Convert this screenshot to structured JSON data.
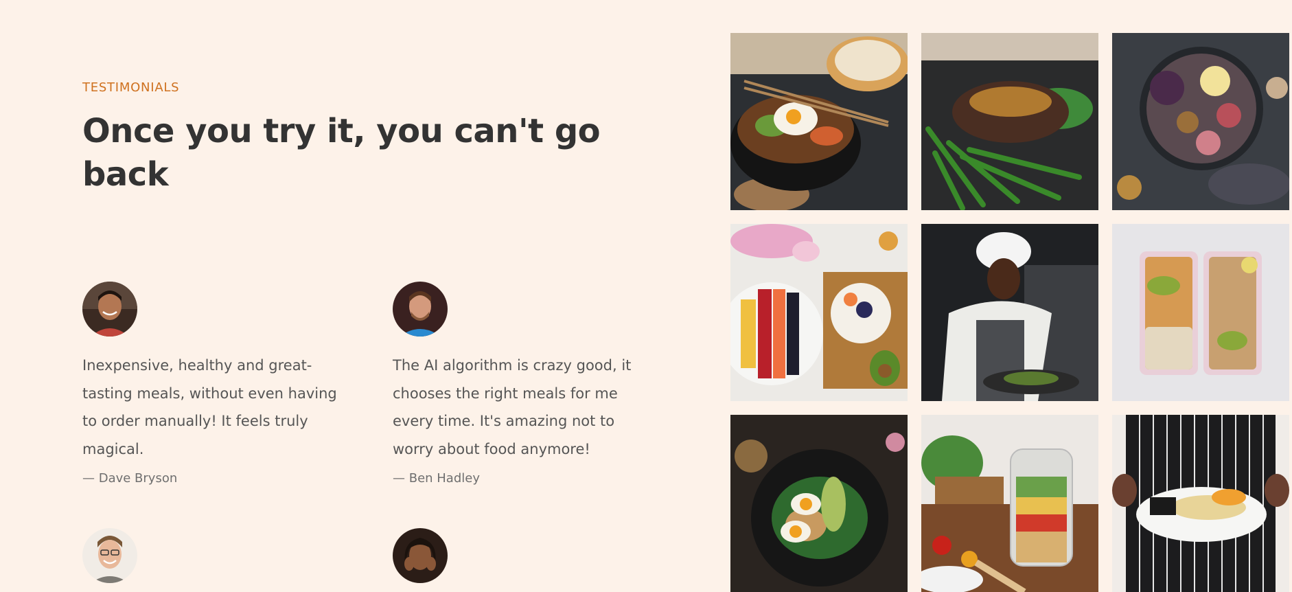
{
  "section": {
    "eyebrow": "Testimonials",
    "heading": "Once you try it, you can't go back"
  },
  "testimonials": [
    {
      "quote": "Inexpensive, healthy and great-tasting meals, without even having to order manually! It feels truly magical.",
      "author": "— Dave Bryson"
    },
    {
      "quote": "The AI algorithm is crazy good, it chooses the right meals for me every time. It's amazing not to worry about food anymore!",
      "author": "— Ben Hadley"
    },
    {
      "quote": "",
      "author": ""
    },
    {
      "quote": "",
      "author": ""
    }
  ],
  "gallery": [
    {
      "icon": "bibimbap-bowl-photo"
    },
    {
      "icon": "steak-asparagus-photo"
    },
    {
      "icon": "figs-platter-photo"
    },
    {
      "icon": "fruit-bowl-photo"
    },
    {
      "icon": "chef-cooking-photo"
    },
    {
      "icon": "meal-prep-containers-photo"
    },
    {
      "icon": "egg-salad-plate-photo"
    },
    {
      "icon": "salad-jar-photo"
    },
    {
      "icon": "chef-serving-plate-photo"
    }
  ],
  "colors": {
    "background": "#fdf2e9",
    "accent": "#cf711f",
    "heading": "#333333",
    "text": "#555555"
  }
}
